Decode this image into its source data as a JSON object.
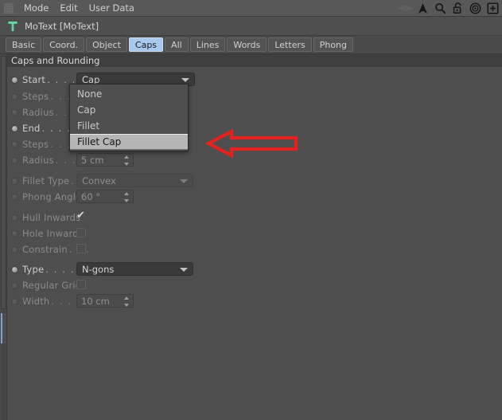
{
  "menubar": {
    "grip_icon": "drag-grip-icon",
    "items": [
      "Mode",
      "Edit",
      "User Data"
    ],
    "right_icons": [
      {
        "name": "layer-diamond-icon",
        "glyph": "diamond"
      },
      {
        "name": "cursor-arrow-icon",
        "glyph": "triangle"
      },
      {
        "name": "search-icon",
        "glyph": "magnifier"
      },
      {
        "name": "unlock-icon",
        "glyph": "padlock-open"
      },
      {
        "name": "target-circle-icon",
        "glyph": "target"
      },
      {
        "name": "add-plus-icon",
        "glyph": "plus-box"
      }
    ]
  },
  "title": {
    "icon": "motext-t-icon",
    "icon_color": "#5fd6a0",
    "text": "MoText [MoText]"
  },
  "tabs": [
    {
      "label": "Basic",
      "active": false
    },
    {
      "label": "Coord.",
      "active": false
    },
    {
      "label": "Object",
      "active": false
    },
    {
      "label": "Caps",
      "active": true
    },
    {
      "label": "All",
      "active": false
    },
    {
      "label": "Lines",
      "active": false
    },
    {
      "label": "Words",
      "active": false
    },
    {
      "label": "Letters",
      "active": false
    },
    {
      "label": "Phong",
      "active": false
    }
  ],
  "section": {
    "header": "Caps and Rounding"
  },
  "rows": {
    "start": {
      "label": "Start",
      "dots": ". . . . . . .",
      "value": "Cap"
    },
    "steps1": {
      "label": "Steps",
      "dots": ". . . . . .",
      "value": ""
    },
    "radius1": {
      "label": "Radius",
      "dots": ". . . . .",
      "value": ""
    },
    "end": {
      "label": "End",
      "dots": ". . . . . . . .",
      "value": ""
    },
    "steps2": {
      "label": "Steps",
      "dots": ". . . . . .",
      "value": ""
    },
    "radius2": {
      "label": "Radius",
      "dots": ". . . . .",
      "value": "5 cm"
    },
    "fillet_type": {
      "label": "Fillet Type",
      "dots": ". . .",
      "value": "Convex"
    },
    "phong_angle": {
      "label": "Phong Angle",
      "dots": "",
      "value": "60 °"
    },
    "hull_inwards": {
      "label": "Hull Inwards",
      "dots": "",
      "checked": true
    },
    "hole_inwards": {
      "label": "Hole Inwards",
      "dots": "",
      "checked": false
    },
    "constrain": {
      "label": "Constrain",
      "dots": ". . .",
      "checked": false
    },
    "type": {
      "label": "Type",
      "dots": ". . . . . . .",
      "value": "N-gons"
    },
    "regular_grid": {
      "label": "Regular Grid",
      "dots": "",
      "checked": false
    },
    "width": {
      "label": "Width",
      "dots": ". . . . . .",
      "value": "10 cm"
    }
  },
  "dropdown": {
    "open": true,
    "options": [
      "None",
      "Cap",
      "Fillet",
      "Fillet Cap"
    ],
    "highlighted": "Fillet Cap"
  },
  "annotation": {
    "shape": "left-arrow",
    "color": "#e2231f"
  },
  "colors": {
    "panel_bg": "#4e4e4e",
    "menubar_bg": "#585858",
    "tab_active_bg": "#a8c8ee",
    "section_bg": "#3f3f3f",
    "field_bg": "#3a3a3a",
    "highlight_bg": "#b5b5b5",
    "accent_red": "#e2231f",
    "icon_green": "#5fd6a0"
  }
}
